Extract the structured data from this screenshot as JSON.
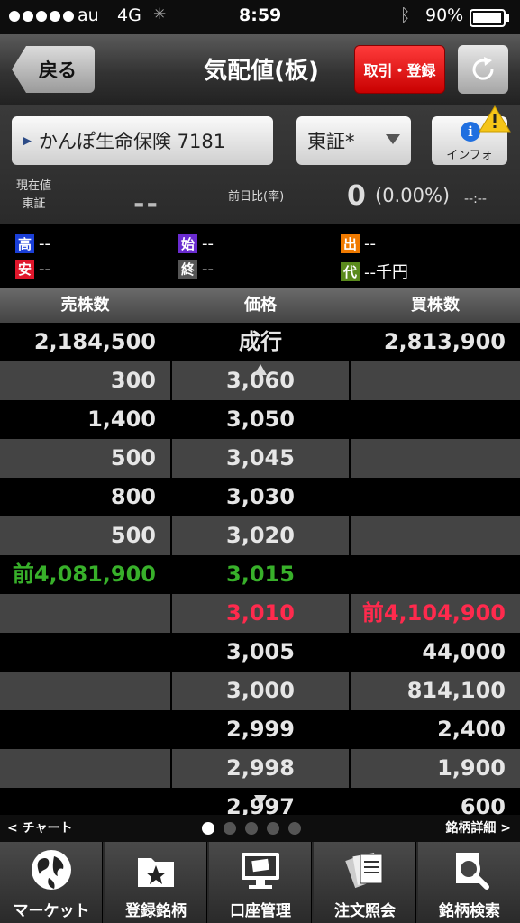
{
  "status_bar": {
    "carrier": "au",
    "network": "4G",
    "time": "8:59",
    "battery": "90%"
  },
  "nav": {
    "back_label": "戻る",
    "title": "気配値(板)",
    "trade_label": "取引・登録"
  },
  "stock": {
    "name_code": "かんぽ生命保険 7181",
    "exchange": "東証*",
    "info_label": "インフォ"
  },
  "quote": {
    "current_label": "現在値",
    "market_label": "東証",
    "current_value": "--",
    "change_label": "前日比(率)",
    "change_value": "0",
    "change_pct": "(0.00%)",
    "change_time": "--:--"
  },
  "ohlc": {
    "high": {
      "badge": "高",
      "value": "--",
      "color": "#1a3fd8"
    },
    "low": {
      "badge": "安",
      "value": "--",
      "color": "#e0162b"
    },
    "open": {
      "badge": "始",
      "value": "--",
      "color": "#6a2bd0"
    },
    "close": {
      "badge": "終",
      "value": "--",
      "color": "#555555"
    },
    "volume": {
      "badge": "出",
      "value": "--",
      "color": "#f07a00"
    },
    "turnover": {
      "badge": "代",
      "value": "--千円",
      "color": "#5a8a1c"
    }
  },
  "board": {
    "headers": {
      "sell": "売株数",
      "price": "価格",
      "buy": "買株数"
    },
    "rows": [
      {
        "sell": "2,184,500",
        "price": "成行",
        "buy": "2,813,900"
      },
      {
        "sell": "300",
        "price": "3,060",
        "buy": ""
      },
      {
        "sell": "1,400",
        "price": "3,050",
        "buy": ""
      },
      {
        "sell": "500",
        "price": "3,045",
        "buy": ""
      },
      {
        "sell": "800",
        "price": "3,030",
        "buy": ""
      },
      {
        "sell": "500",
        "price": "3,020",
        "buy": ""
      },
      {
        "sell": "前4,081,900",
        "price": "3,015",
        "buy": ""
      },
      {
        "sell": "",
        "price": "3,010",
        "buy": "前4,104,900"
      },
      {
        "sell": "",
        "price": "3,005",
        "buy": "44,000"
      },
      {
        "sell": "",
        "price": "3,000",
        "buy": "814,100"
      },
      {
        "sell": "",
        "price": "2,999",
        "buy": "2,400"
      },
      {
        "sell": "",
        "price": "2,998",
        "buy": "1,900"
      },
      {
        "sell": "",
        "price": "2,997",
        "buy": "600"
      }
    ],
    "colors": {
      "sell_special": "#38b02a",
      "buy_special": "#ff2a4d",
      "normal": "#e6e6e6"
    }
  },
  "pager": {
    "left_label": "< チャート",
    "right_label": "銘柄詳細 >",
    "pages": 5,
    "current": 1
  },
  "tabs": [
    {
      "label": "マーケット",
      "icon": "globe-icon"
    },
    {
      "label": "登録銘柄",
      "icon": "folder-star-icon"
    },
    {
      "label": "口座管理",
      "icon": "monitor-icon"
    },
    {
      "label": "注文照会",
      "icon": "documents-icon"
    },
    {
      "label": "銘柄検索",
      "icon": "search-icon"
    }
  ]
}
